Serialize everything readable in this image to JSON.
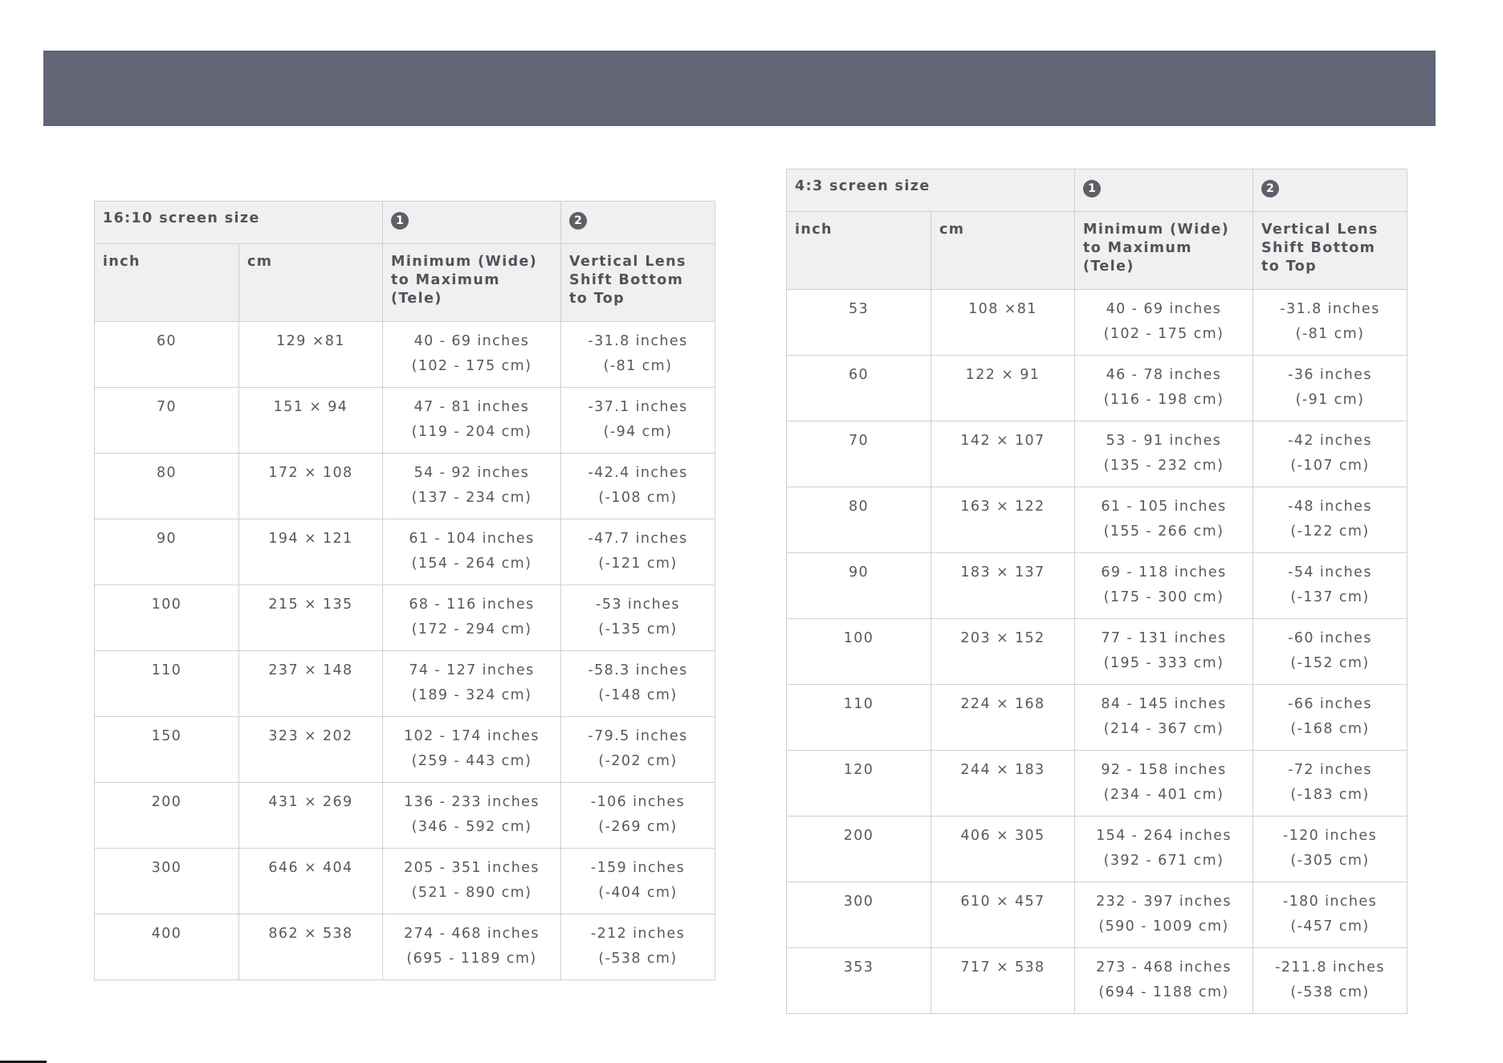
{
  "tables": [
    {
      "title": "16:10 screen size",
      "marker1": "1",
      "marker2": "2",
      "columns": [
        "inch",
        "cm",
        "Minimum (Wide) to Maximum (Tele)",
        "Vertical Lens Shift Bottom to Top"
      ],
      "rows": [
        {
          "inch": "60",
          "cm": "129 ×81",
          "range_in": "40 - 69 inches",
          "range_cm": "(102 - 175 cm)",
          "shift_in": "-31.8 inches",
          "shift_cm": "(-81 cm)"
        },
        {
          "inch": "70",
          "cm": "151 × 94",
          "range_in": "47 - 81 inches",
          "range_cm": "(119 - 204 cm)",
          "shift_in": "-37.1 inches",
          "shift_cm": "(-94 cm)"
        },
        {
          "inch": "80",
          "cm": "172 × 108",
          "range_in": "54 - 92 inches",
          "range_cm": "(137 - 234 cm)",
          "shift_in": "-42.4 inches",
          "shift_cm": "(-108 cm)"
        },
        {
          "inch": "90",
          "cm": "194 × 121",
          "range_in": "61 - 104 inches",
          "range_cm": "(154 - 264 cm)",
          "shift_in": "-47.7 inches",
          "shift_cm": "(-121 cm)"
        },
        {
          "inch": "100",
          "cm": "215 × 135",
          "range_in": "68 - 116 inches",
          "range_cm": "(172 - 294 cm)",
          "shift_in": "-53 inches",
          "shift_cm": "(-135 cm)"
        },
        {
          "inch": "110",
          "cm": "237 × 148",
          "range_in": "74 - 127 inches",
          "range_cm": "(189 - 324 cm)",
          "shift_in": "-58.3 inches",
          "shift_cm": "(-148 cm)"
        },
        {
          "inch": "150",
          "cm": "323 × 202",
          "range_in": "102 - 174 inches",
          "range_cm": "(259 - 443 cm)",
          "shift_in": "-79.5 inches",
          "shift_cm": "(-202 cm)"
        },
        {
          "inch": "200",
          "cm": "431 × 269",
          "range_in": "136 - 233 inches",
          "range_cm": "(346 - 592 cm)",
          "shift_in": "-106 inches",
          "shift_cm": "(-269 cm)"
        },
        {
          "inch": "300",
          "cm": "646 × 404",
          "range_in": "205 - 351 inches",
          "range_cm": "(521 - 890 cm)",
          "shift_in": "-159 inches",
          "shift_cm": "(-404 cm)"
        },
        {
          "inch": "400",
          "cm": "862 × 538",
          "range_in": "274 - 468 inches",
          "range_cm": "(695 - 1189 cm)",
          "shift_in": "-212 inches",
          "shift_cm": "(-538 cm)"
        }
      ]
    },
    {
      "title": "4:3 screen size",
      "marker1": "1",
      "marker2": "2",
      "columns": [
        "inch",
        "cm",
        "Minimum (Wide) to Maximum (Tele)",
        "Vertical Lens Shift Bottom to Top"
      ],
      "rows": [
        {
          "inch": "53",
          "cm": "108 ×81",
          "range_in": "40 - 69 inches",
          "range_cm": "(102 - 175 cm)",
          "shift_in": "-31.8 inches",
          "shift_cm": "(-81 cm)"
        },
        {
          "inch": "60",
          "cm": "122 × 91",
          "range_in": "46 - 78 inches",
          "range_cm": "(116 - 198 cm)",
          "shift_in": "-36 inches",
          "shift_cm": "(-91 cm)"
        },
        {
          "inch": "70",
          "cm": "142 × 107",
          "range_in": "53 - 91 inches",
          "range_cm": "(135 - 232 cm)",
          "shift_in": "-42 inches",
          "shift_cm": "(-107 cm)"
        },
        {
          "inch": "80",
          "cm": "163 × 122",
          "range_in": "61 - 105 inches",
          "range_cm": "(155 - 266 cm)",
          "shift_in": "-48 inches",
          "shift_cm": "(-122 cm)"
        },
        {
          "inch": "90",
          "cm": "183 × 137",
          "range_in": "69 - 118 inches",
          "range_cm": "(175 - 300 cm)",
          "shift_in": "-54 inches",
          "shift_cm": "(-137 cm)"
        },
        {
          "inch": "100",
          "cm": "203 × 152",
          "range_in": "77 - 131 inches",
          "range_cm": "(195 - 333 cm)",
          "shift_in": "-60 inches",
          "shift_cm": "(-152 cm)"
        },
        {
          "inch": "110",
          "cm": "224 × 168",
          "range_in": "84 - 145 inches",
          "range_cm": "(214 - 367 cm)",
          "shift_in": "-66 inches",
          "shift_cm": "(-168 cm)"
        },
        {
          "inch": "120",
          "cm": "244 × 183",
          "range_in": "92 - 158 inches",
          "range_cm": "(234 - 401 cm)",
          "shift_in": "-72 inches",
          "shift_cm": "(-183 cm)"
        },
        {
          "inch": "200",
          "cm": "406 × 305",
          "range_in": "154 - 264 inches",
          "range_cm": "(392 - 671 cm)",
          "shift_in": "-120 inches",
          "shift_cm": "(-305 cm)"
        },
        {
          "inch": "300",
          "cm": "610 × 457",
          "range_in": "232 - 397 inches",
          "range_cm": "(590 - 1009 cm)",
          "shift_in": "-180 inches",
          "shift_cm": "(-457 cm)"
        },
        {
          "inch": "353",
          "cm": "717 × 538",
          "range_in": "273 - 468 inches",
          "range_cm": "(694 - 1188 cm)",
          "shift_in": "-211.8 inches",
          "shift_cm": "(-538 cm)"
        }
      ]
    }
  ]
}
